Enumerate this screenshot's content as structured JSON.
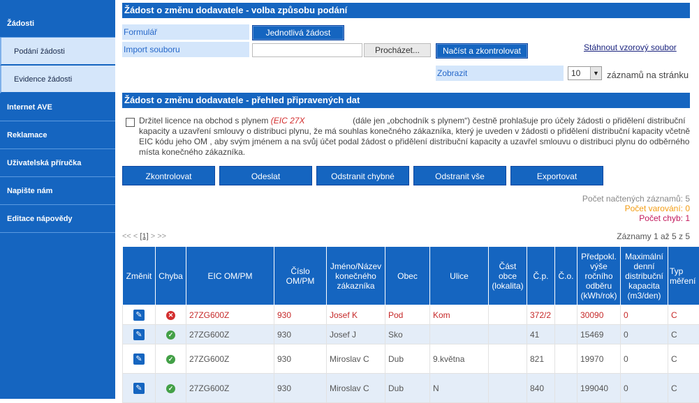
{
  "sidebar": {
    "group_zadosti": "Žádosti",
    "sub_podani": "Podání žádosti",
    "sub_evidence": "Evidence žádosti",
    "group_internet": "Internet AVE",
    "group_reklamace": "Reklamace",
    "group_prirucka": "Uživatelská příručka",
    "group_napiste": "Napište nám",
    "group_editace": "Editace nápovědy"
  },
  "submit_section": {
    "title": "Žádost o změnu dodavatele - volba způsobu podání",
    "form_label": "Formulář",
    "single_button": "Jednotlivá žádost",
    "import_label": "Import souboru",
    "file_value": "",
    "browse_button": "Procházet...",
    "load_button": "Načíst a zkontrolovat",
    "download_link": "Stáhnout vzorový soubor",
    "show_label": "Zobrazit",
    "page_size": "10",
    "per_page_text": "záznamů na stránku"
  },
  "overview_section": {
    "title": "Žádost o změnu dodavatele - přehled připravených dat",
    "declaration_prefix": "Držitel licence na obchod s plynem",
    "declaration_eic": "(EIC  27X",
    "declaration_rest": "(dále jen „obchodník s plynem“) čestně prohlašuje pro účely žádosti o přidělení distribuční kapacity a uzavření smlouvy o distribuci plynu, že má souhlas konečného zákazníka, který je uveden v žádosti o přidělení distribuční kapacity včetně EIC kódu jeho OM , aby svým jménem a na svůj účet podal žádost o přidělení distribuční kapacity a uzavřel smlouvu o distribuci plynu do odběrného místa konečného zákazníka."
  },
  "actions": {
    "check": "Zkontrolovat",
    "send": "Odeslat",
    "remove_invalid": "Odstranit chybné",
    "remove_all": "Odstranit vše",
    "export": "Exportovat"
  },
  "stats": {
    "loaded": "Počet načtených záznamů: 5",
    "warnings": "Počet varování: 0",
    "errors": "Počet chyb: 1"
  },
  "pager": {
    "first": "<<",
    "prev": "<",
    "current": "[1]",
    "next": ">",
    "last": ">>",
    "records": "Záznamy 1 až 5 z 5"
  },
  "colors": {
    "accent": "#1565c0",
    "error": "#d32f2f",
    "warning": "#f39c12",
    "error_count": "#c2185b",
    "ok": "#43a047"
  },
  "table": {
    "headers": [
      "Změnit",
      "Chyba",
      "EIC OM/PM",
      "Číslo OM/PM",
      "Jméno/Název konečného zákazníka",
      "Obec",
      "Ulice",
      "Část obce (lokalita)",
      "Č.p.",
      "Č.o.",
      "Předpokl. výše ročního odběru (kWh/rok)",
      "Maximální denní distribuční kapacita (m3/den)",
      "Typ měření"
    ],
    "rows": [
      {
        "status": "error",
        "eic": "27ZG600Z",
        "cislo": "930",
        "jmeno": "Josef K",
        "obec": "Pod",
        "ulice": "Kom",
        "cast": "",
        "cp": "372/2",
        "co": "",
        "odber": "30090",
        "kapacita": "0",
        "typ": "C"
      },
      {
        "status": "ok",
        "eic": "27ZG600Z",
        "cislo": "930",
        "jmeno": "Josef J",
        "obec": "Sko",
        "ulice": "",
        "cast": "",
        "cp": "41",
        "co": "",
        "odber": "15469",
        "kapacita": "0",
        "typ": "C"
      },
      {
        "status": "ok",
        "eic": "27ZG600Z",
        "cislo": "930",
        "jmeno": "Miroslav C",
        "obec": "Dub",
        "ulice": "9.května",
        "cast": "",
        "cp": "821",
        "co": "",
        "odber": "19970",
        "kapacita": "0",
        "typ": "C"
      },
      {
        "status": "ok",
        "eic": "27ZG600Z",
        "cislo": "930",
        "jmeno": "Miroslav C",
        "obec": "Dub",
        "ulice": "N",
        "cast": "",
        "cp": "840",
        "co": "",
        "odber": "199040",
        "kapacita": "0",
        "typ": "C"
      }
    ]
  }
}
